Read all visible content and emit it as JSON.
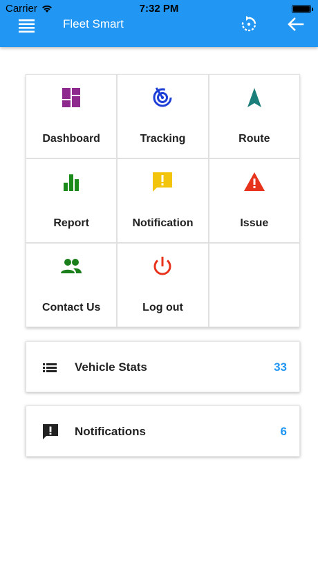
{
  "status_bar": {
    "carrier": "Carrier",
    "time": "7:32 PM"
  },
  "toolbar": {
    "title": "Fleet Smart"
  },
  "colors": {
    "primary": "#2196f3",
    "dashboard": "#8e2a8e",
    "tracking": "#1e3fd6",
    "route": "#1a7f7a",
    "report": "#1a8a1a",
    "notification": "#f2c40c",
    "issue": "#e8331c",
    "contact": "#1a7f1a",
    "logout": "#e8331c",
    "count": "#2196f3"
  },
  "menu": {
    "dashboard": "Dashboard",
    "tracking": "Tracking",
    "route": "Route",
    "report": "Report",
    "notification": "Notification",
    "issue": "Issue",
    "contact": "Contact Us",
    "logout": "Log out"
  },
  "cards": {
    "vehicle_stats": {
      "label": "Vehicle Stats",
      "count": "33"
    },
    "notifications": {
      "label": "Notifications",
      "count": "6"
    }
  }
}
